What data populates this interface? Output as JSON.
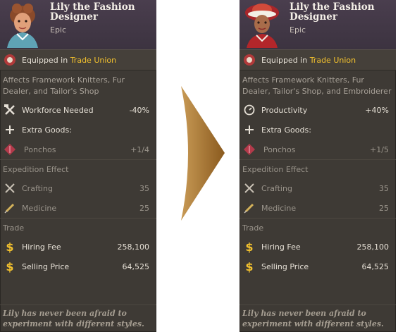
{
  "left": {
    "name": "Lily the Fashion Designer",
    "rarity": "Epic",
    "equipped_prefix": "Equipped in",
    "equipped_building": "Trade Union",
    "affects": "Affects Framework Knitters, Fur Dealer, and Tailor's Shop",
    "stat_label": "Workforce Needed",
    "stat_value": "-40%",
    "extra_goods_label": "Extra Goods:",
    "good_name": "Ponchos",
    "good_value": "+1/4",
    "expedition_header": "Expedition Effect",
    "crafting_label": "Crafting",
    "crafting_value": "35",
    "medicine_label": "Medicine",
    "medicine_value": "25",
    "trade_header": "Trade",
    "hiring_label": "Hiring Fee",
    "hiring_value": "258,100",
    "selling_label": "Selling Price",
    "selling_value": "64,525",
    "quote": "Lily has never been afraid to experiment with different styles."
  },
  "right": {
    "name": "Lily the Fashion Designer",
    "rarity": "Epic",
    "equipped_prefix": "Equipped in",
    "equipped_building": "Trade Union",
    "affects": "Affects Framework Knitters, Fur Dealer, Tailor's Shop, and Embroiderer",
    "stat_label": "Productivity",
    "stat_value": "+40%",
    "extra_goods_label": "Extra Goods:",
    "good_name": "Ponchos",
    "good_value": "+1/5",
    "expedition_header": "Expedition Effect",
    "crafting_label": "Crafting",
    "crafting_value": "35",
    "medicine_label": "Medicine",
    "medicine_value": "25",
    "trade_header": "Trade",
    "hiring_label": "Hiring Fee",
    "hiring_value": "258,100",
    "selling_label": "Selling Price",
    "selling_value": "64,525",
    "quote": "Lily has never been afraid to experiment with different styles."
  },
  "colors": {
    "panel": "#3e3a35",
    "header": "#45394a",
    "gold": "#f2c12e",
    "arrow": "#a9742b"
  },
  "icons": {
    "stat_left": "hammer-wrench-icon",
    "stat_right": "gear-icon",
    "extra_goods": "plus-icon",
    "good": "poncho-icon",
    "crafting": "tools-icon",
    "medicine": "syringe-icon",
    "money": "dollar-icon",
    "equipped": "trade-union-icon"
  }
}
